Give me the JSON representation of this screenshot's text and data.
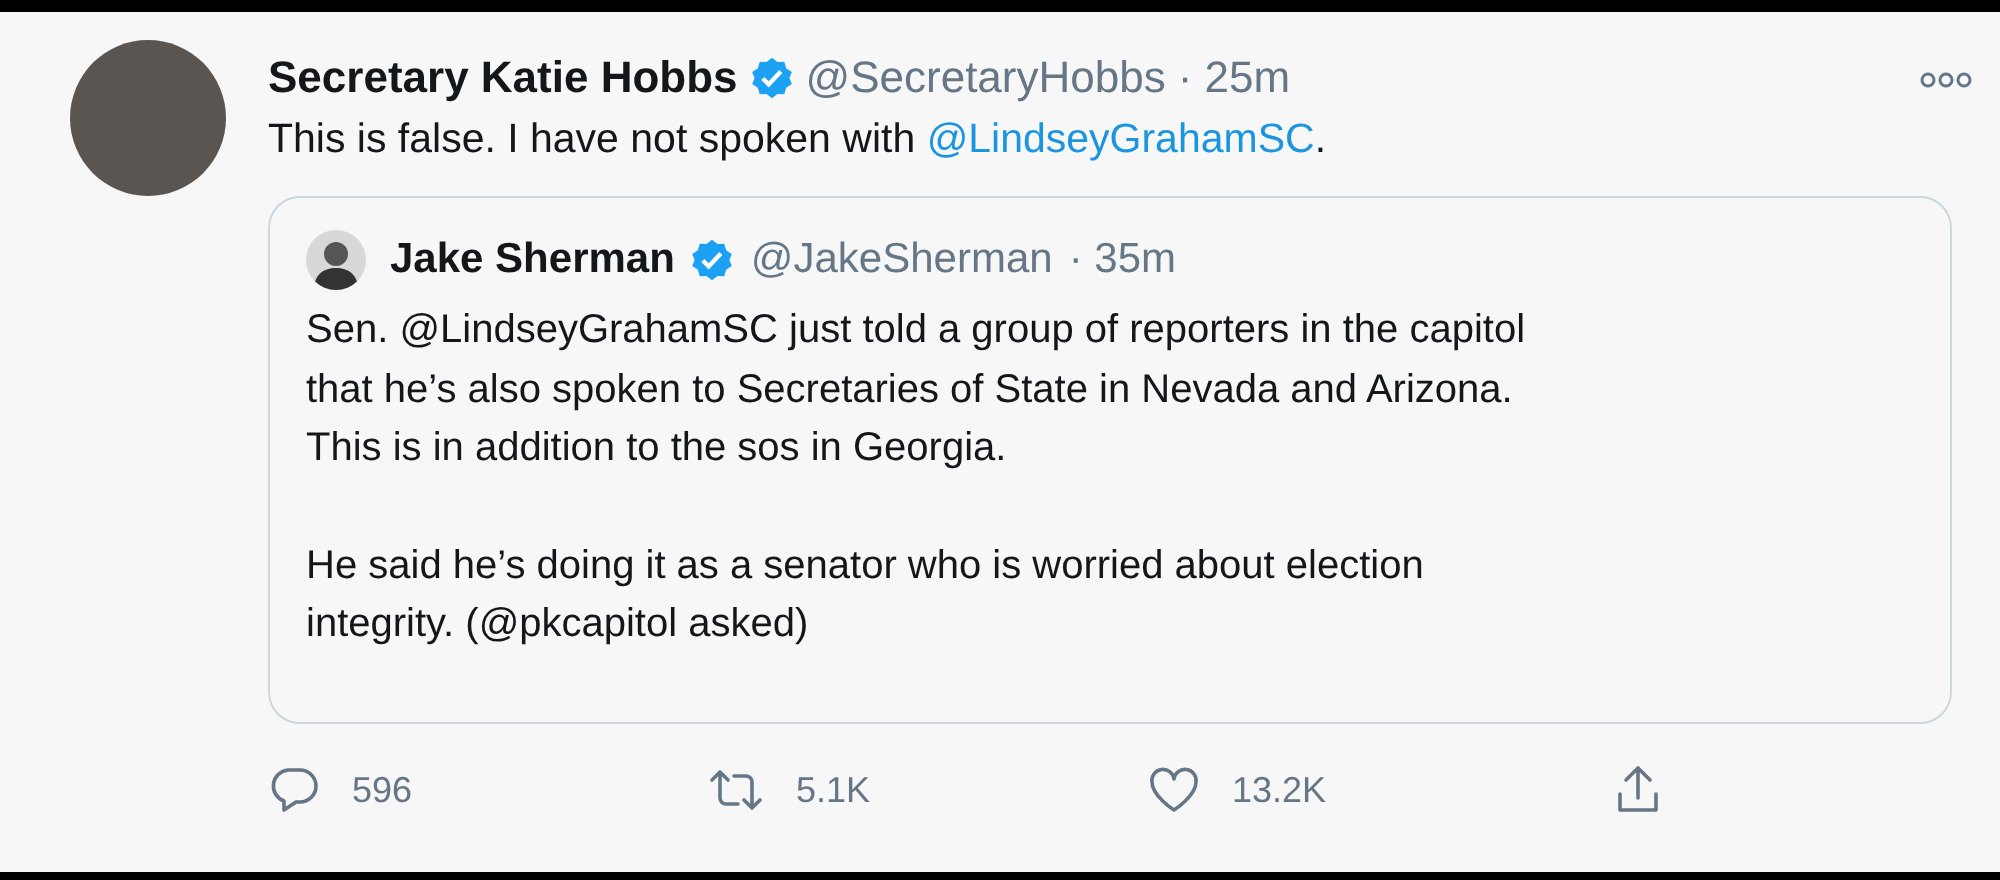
{
  "tweet": {
    "author": "Secretary Katie Hobbs",
    "verified": true,
    "handle": "@SecretaryHobbs",
    "time": "· 25m",
    "text": [
      {
        "kind": "text",
        "text": "This is false. I have not spoken with "
      },
      {
        "kind": "link",
        "text": "@LindseyGrahamSC"
      },
      {
        "kind": "text",
        "text": "."
      }
    ],
    "quote": {
      "author": "Jake Sherman",
      "verified": true,
      "handle": "@JakeSherman",
      "time": "· 35m",
      "paragraphs": [
        [
          "Sen. @LindseyGrahamSC just told a group of reporters in the capitol",
          "that he’s also spoken to Secretaries of State in Nevada and Arizona.",
          "This is in addition to the sos in Georgia."
        ],
        [
          "He said he’s doing it as a senator who is worried about election",
          "integrity. (@pkcapitol asked)"
        ]
      ]
    },
    "actions": [
      {
        "kind": "reply",
        "count": "596"
      },
      {
        "kind": "retweet",
        "count": "5.1K"
      },
      {
        "kind": "like",
        "count": "13.2K"
      },
      {
        "kind": "share"
      }
    ]
  }
}
